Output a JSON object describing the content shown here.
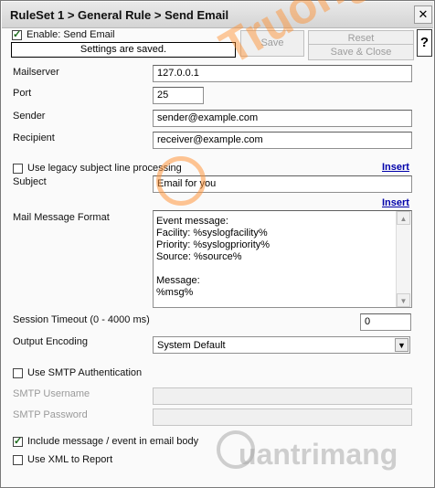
{
  "window": {
    "title": "RuleSet 1  > General Rule > Send Email"
  },
  "toolbar": {
    "enable_label": "Enable: Send Email",
    "enable_checked": true,
    "status_text": "Settings are saved.",
    "save_label": "Save",
    "reset_label": "Reset",
    "save_close_label": "Save & Close",
    "help_label": "?"
  },
  "form": {
    "mailserver": {
      "label": "Mailserver",
      "value": "127.0.0.1"
    },
    "port": {
      "label": "Port",
      "value": "25"
    },
    "sender": {
      "label": "Sender",
      "value": "sender@example.com"
    },
    "recipient": {
      "label": "Recipient",
      "value": "receiver@example.com"
    },
    "legacy": {
      "label": "Use legacy subject line processing",
      "checked": false
    },
    "insert_label": "Insert",
    "subject": {
      "label": "Subject",
      "value": "Email for you"
    },
    "message": {
      "label": "Mail Message Format",
      "value": "Event message:\nFacility: %syslogfacility%\nPriority: %syslogpriority%\nSource: %source%\n\nMessage:\n%msg%"
    },
    "session_timeout": {
      "label": "Session Timeout (0 - 4000 ms)",
      "value": "0"
    },
    "output_encoding": {
      "label": "Output Encoding",
      "value": "System Default"
    },
    "smtp_auth": {
      "label": "Use SMTP Authentication",
      "checked": false
    },
    "smtp_username": {
      "label": "SMTP Username",
      "value": ""
    },
    "smtp_password": {
      "label": "SMTP Password",
      "value": ""
    },
    "include_body": {
      "label": "Include message / event in email body",
      "checked": true
    },
    "xml_report": {
      "label": "Use XML to Report",
      "checked": false
    }
  },
  "watermarks": {
    "top": "Truongtin.on",
    "bottom": "uantrimang"
  }
}
